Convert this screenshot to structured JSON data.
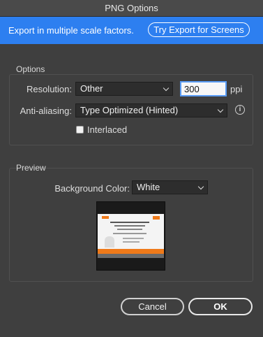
{
  "window": {
    "title": "PNG Options"
  },
  "banner": {
    "text": "Export in multiple scale factors.",
    "button_label": "Try Export for Screens"
  },
  "options": {
    "legend": "Options",
    "resolution": {
      "label": "Resolution:",
      "value": "Other",
      "dpi_value": "300",
      "unit": "ppi"
    },
    "anti_aliasing": {
      "label": "Anti-aliasing:",
      "value": "Type Optimized (Hinted)"
    },
    "interlaced": {
      "label": "Interlaced",
      "checked": false
    }
  },
  "preview": {
    "legend": "Preview",
    "background_color": {
      "label": "Background Color:",
      "value": "White"
    }
  },
  "buttons": {
    "cancel": "Cancel",
    "ok": "OK"
  },
  "colors": {
    "banner": "#2d7ff0",
    "dialog_bg": "#3f3f3f",
    "field_bg": "#2d2d2d",
    "thumb_accent": "#ef7a1a"
  },
  "icons": {
    "info": "info-icon",
    "chevron": "chevron-down-icon"
  }
}
